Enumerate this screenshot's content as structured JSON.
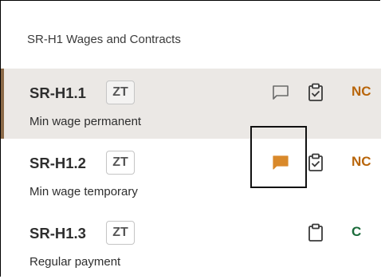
{
  "section": {
    "title": "SR-H1 Wages and Contracts"
  },
  "rows": [
    {
      "code": "SR-H1.1",
      "badge": "ZT",
      "description": "Min wage permanent",
      "comment_icon": "comment-outline-icon",
      "clipboard_icon": "clipboard-check-icon",
      "status": "NC",
      "status_color": "#b8650a",
      "selected": true
    },
    {
      "code": "SR-H1.2",
      "badge": "ZT",
      "description": "Min wage temporary",
      "comment_icon": "comment-filled-icon",
      "comment_color": "#d9892a",
      "clipboard_icon": "clipboard-check-icon",
      "status": "NC",
      "status_color": "#b8650a",
      "highlighted": true
    },
    {
      "code": "SR-H1.3",
      "badge": "ZT",
      "description": "Regular payment",
      "clipboard_icon": "clipboard-icon",
      "status": "C",
      "status_color": "#1a6b3a"
    }
  ],
  "colors": {
    "selected_row_bg": "#ebe8e5",
    "selected_row_accent": "#8b6a48",
    "nc": "#b8650a",
    "c": "#1a6b3a",
    "comment_filled": "#d9892a"
  }
}
